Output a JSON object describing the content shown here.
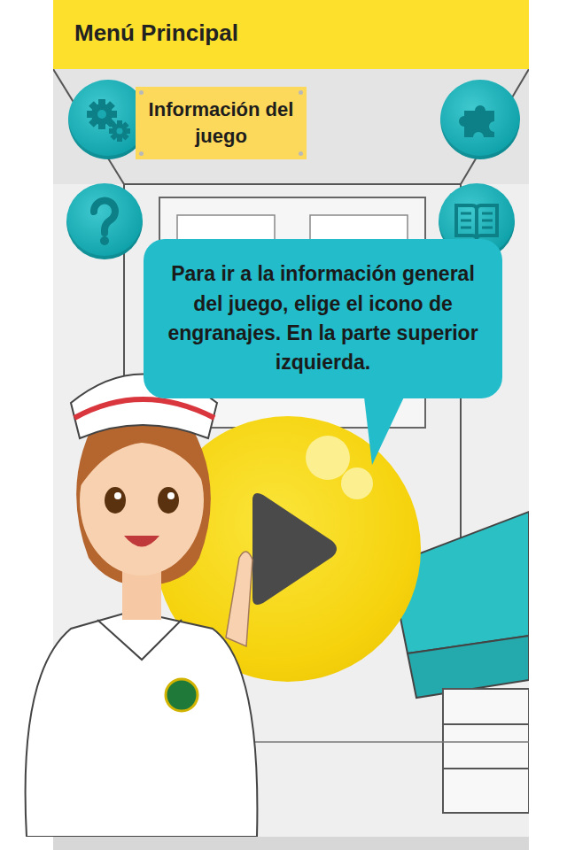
{
  "header": {
    "title": "Menú Principal"
  },
  "menu": {
    "label": "Información del juego"
  },
  "tutorial": {
    "message": "Para ir a la información general del juego, elige el icono de engranajes. En la parte superior izquierda."
  }
}
